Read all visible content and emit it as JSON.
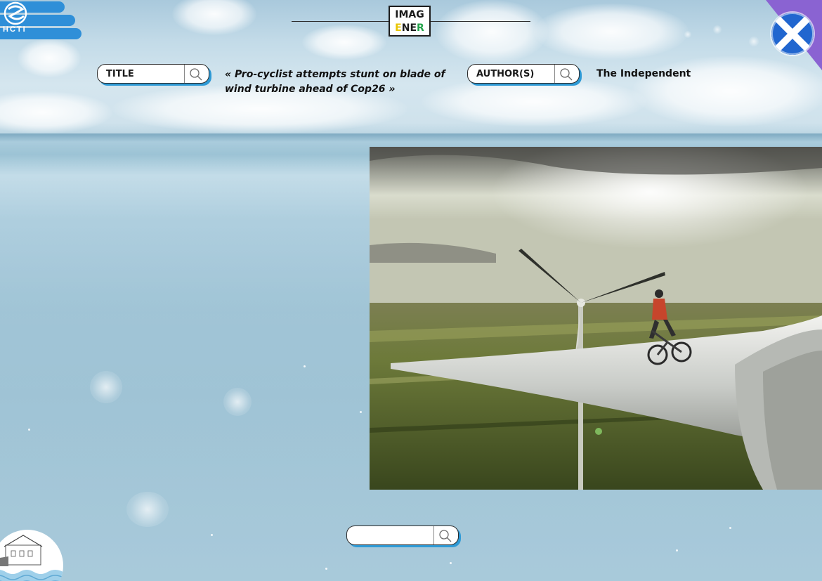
{
  "header": {
    "logo_left": "HCTI",
    "brand_line1": "IMAG",
    "brand_e": "E",
    "brand_ne": "NE",
    "brand_r": "R"
  },
  "search": {
    "title_label": "TITLE",
    "author_label": "AUTHOR(S)",
    "bottom_placeholder": ""
  },
  "article": {
    "title": "« Pro-cyclist attempts stunt on blade of wind turbine ahead of Cop26 »",
    "author": "The Independent"
  },
  "icons": {
    "search": "search-icon",
    "flag": "scotland-flag-icon"
  },
  "colors": {
    "accent_blue": "#2e9ad6",
    "brand_yellow": "#e8c500",
    "brand_green": "#23a34a",
    "corner_purple": "#8a63d2"
  }
}
